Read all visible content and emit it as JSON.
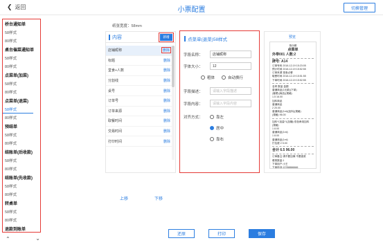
{
  "header": {
    "back_label": "返回",
    "title": "小票配置",
    "button_label": "切换管理"
  },
  "sidebar": {
    "items": [
      {
        "type": "group",
        "label": "桥台通知单"
      },
      {
        "type": "item",
        "label": "58样式"
      },
      {
        "type": "item",
        "label": "80样式"
      },
      {
        "type": "group",
        "label": "桌台催菜通知单"
      },
      {
        "type": "item",
        "label": "58样式"
      },
      {
        "type": "item",
        "label": "80样式"
      },
      {
        "type": "group",
        "label": "点菜单(加菜)"
      },
      {
        "type": "item",
        "label": "58样式"
      },
      {
        "type": "item",
        "label": "80样式"
      },
      {
        "type": "group",
        "label": "点菜单(退菜)"
      },
      {
        "type": "item",
        "label": "58样式",
        "active": true
      },
      {
        "type": "item",
        "label": "80样式"
      },
      {
        "type": "group",
        "label": "预结单"
      },
      {
        "type": "item",
        "label": "58样式"
      },
      {
        "type": "item",
        "label": "80样式"
      },
      {
        "type": "group",
        "label": "结账单(后收款)"
      },
      {
        "type": "item",
        "label": "58样式"
      },
      {
        "type": "item",
        "label": "80样式"
      },
      {
        "type": "group",
        "label": "结账单(先收款)"
      },
      {
        "type": "item",
        "label": "58样式"
      },
      {
        "type": "item",
        "label": "80样式"
      },
      {
        "type": "group",
        "label": "转桌单"
      },
      {
        "type": "item",
        "label": "58样式"
      },
      {
        "type": "item",
        "label": "80样式"
      },
      {
        "type": "group",
        "label": "退款到账单"
      }
    ],
    "up_arrow": "⌄",
    "down_arrow": "⌄"
  },
  "paper_width": "纸张宽度：58mm",
  "content": {
    "title": "内容",
    "add_label": "新增",
    "delete_label": "删除",
    "rows": [
      "店铺昵称",
      "标题",
      "堂食+人数",
      "分割线",
      "桌号",
      "订单号",
      "订单来源",
      "取餐时间",
      "交易时间",
      "打印时间"
    ],
    "up_label": "上移",
    "down_label": "下移"
  },
  "form": {
    "title": "点菜单(退菜)58样式",
    "field_name_label": "字段名称：",
    "field_name_value": "店铺昵称",
    "font_size_label": "字体大小：",
    "font_size_value": "12",
    "bold_label": "粗体",
    "wrap_label": "自动换行",
    "desc_label": "字段描述：",
    "desc_placeholder": "请输入字段描述",
    "content_label": "字段内容：",
    "content_placeholder": "请输入字段内容",
    "align_label": "对齐方式：",
    "align_options": [
      "靠左",
      "居中",
      "靠右"
    ],
    "align_selected": 1
  },
  "preview": {
    "title": "预览",
    "lines": [
      {
        "t": "快乐餐",
        "c": true
      },
      {
        "t": "点菜单",
        "c": true,
        "b": true
      },
      {
        "t": "外带001 人数:2",
        "b": true
      },
      {
        "t": "---"
      },
      {
        "t": "牌号: A14",
        "b": true
      },
      {
        "t": "订单号码 2018-12-19 15:23:05"
      },
      {
        "t": "预计时间 2018-12-19 15:52:55"
      },
      {
        "t": "订单来源 堂食点餐"
      },
      {
        "t": "取餐时间 2018-12-19 15:51:55"
      },
      {
        "t": "下单时间 2018-12-19 15:52:55"
      },
      {
        "t": "---"
      },
      {
        "t": "名称       数量  金额"
      },
      {
        "t": "普通商品(1元款)(下单)"
      },
      {
        "t": "(套餐)(商品)(规格)"
      },
      {
        "t": "                1.5   16.00"
      },
      {
        "t": "加料商品"
      },
      {
        "t": "普通商品"
      },
      {
        "t": "                 2    20.00"
      },
      {
        "t": "普通商品(1ml)(加料)(规格)"
      },
      {
        "t": "(规格)               96.00"
      },
      {
        "t": "---"
      },
      {
        "t": "加料*1加量*1(加糖)  双色串烧加料"
      },
      {
        "t": "(规格)"
      },
      {
        "t": "                 1     8.00"
      },
      {
        "t": "普通商品(1ml)"
      },
      {
        "t": "                 1     8.00"
      },
      {
        "t": "普通商品(1ml)"
      },
      {
        "t": "打包费            2     5.00"
      },
      {
        "t": "---"
      },
      {
        "t": "合计           6.5   96.00",
        "b": true
      },
      {
        "t": "---"
      },
      {
        "t": "订单备注:请不要加辣 不要香菜"
      },
      {
        "t": "餐具数量:1"
      },
      {
        "t": "下单用户:小王"
      },
      {
        "t": "下单电话:13788886666"
      },
      {
        "t": "---"
      },
      {
        "t": "感谢光临 欢迎下次再来"
      },
      {
        "t": "客服热线 400-888-8888"
      },
      {
        "t": "Powered by 收银软件·电子版"
      }
    ]
  },
  "footer": {
    "back_label": "还原",
    "print_label": "打印",
    "save_label": "保存"
  }
}
